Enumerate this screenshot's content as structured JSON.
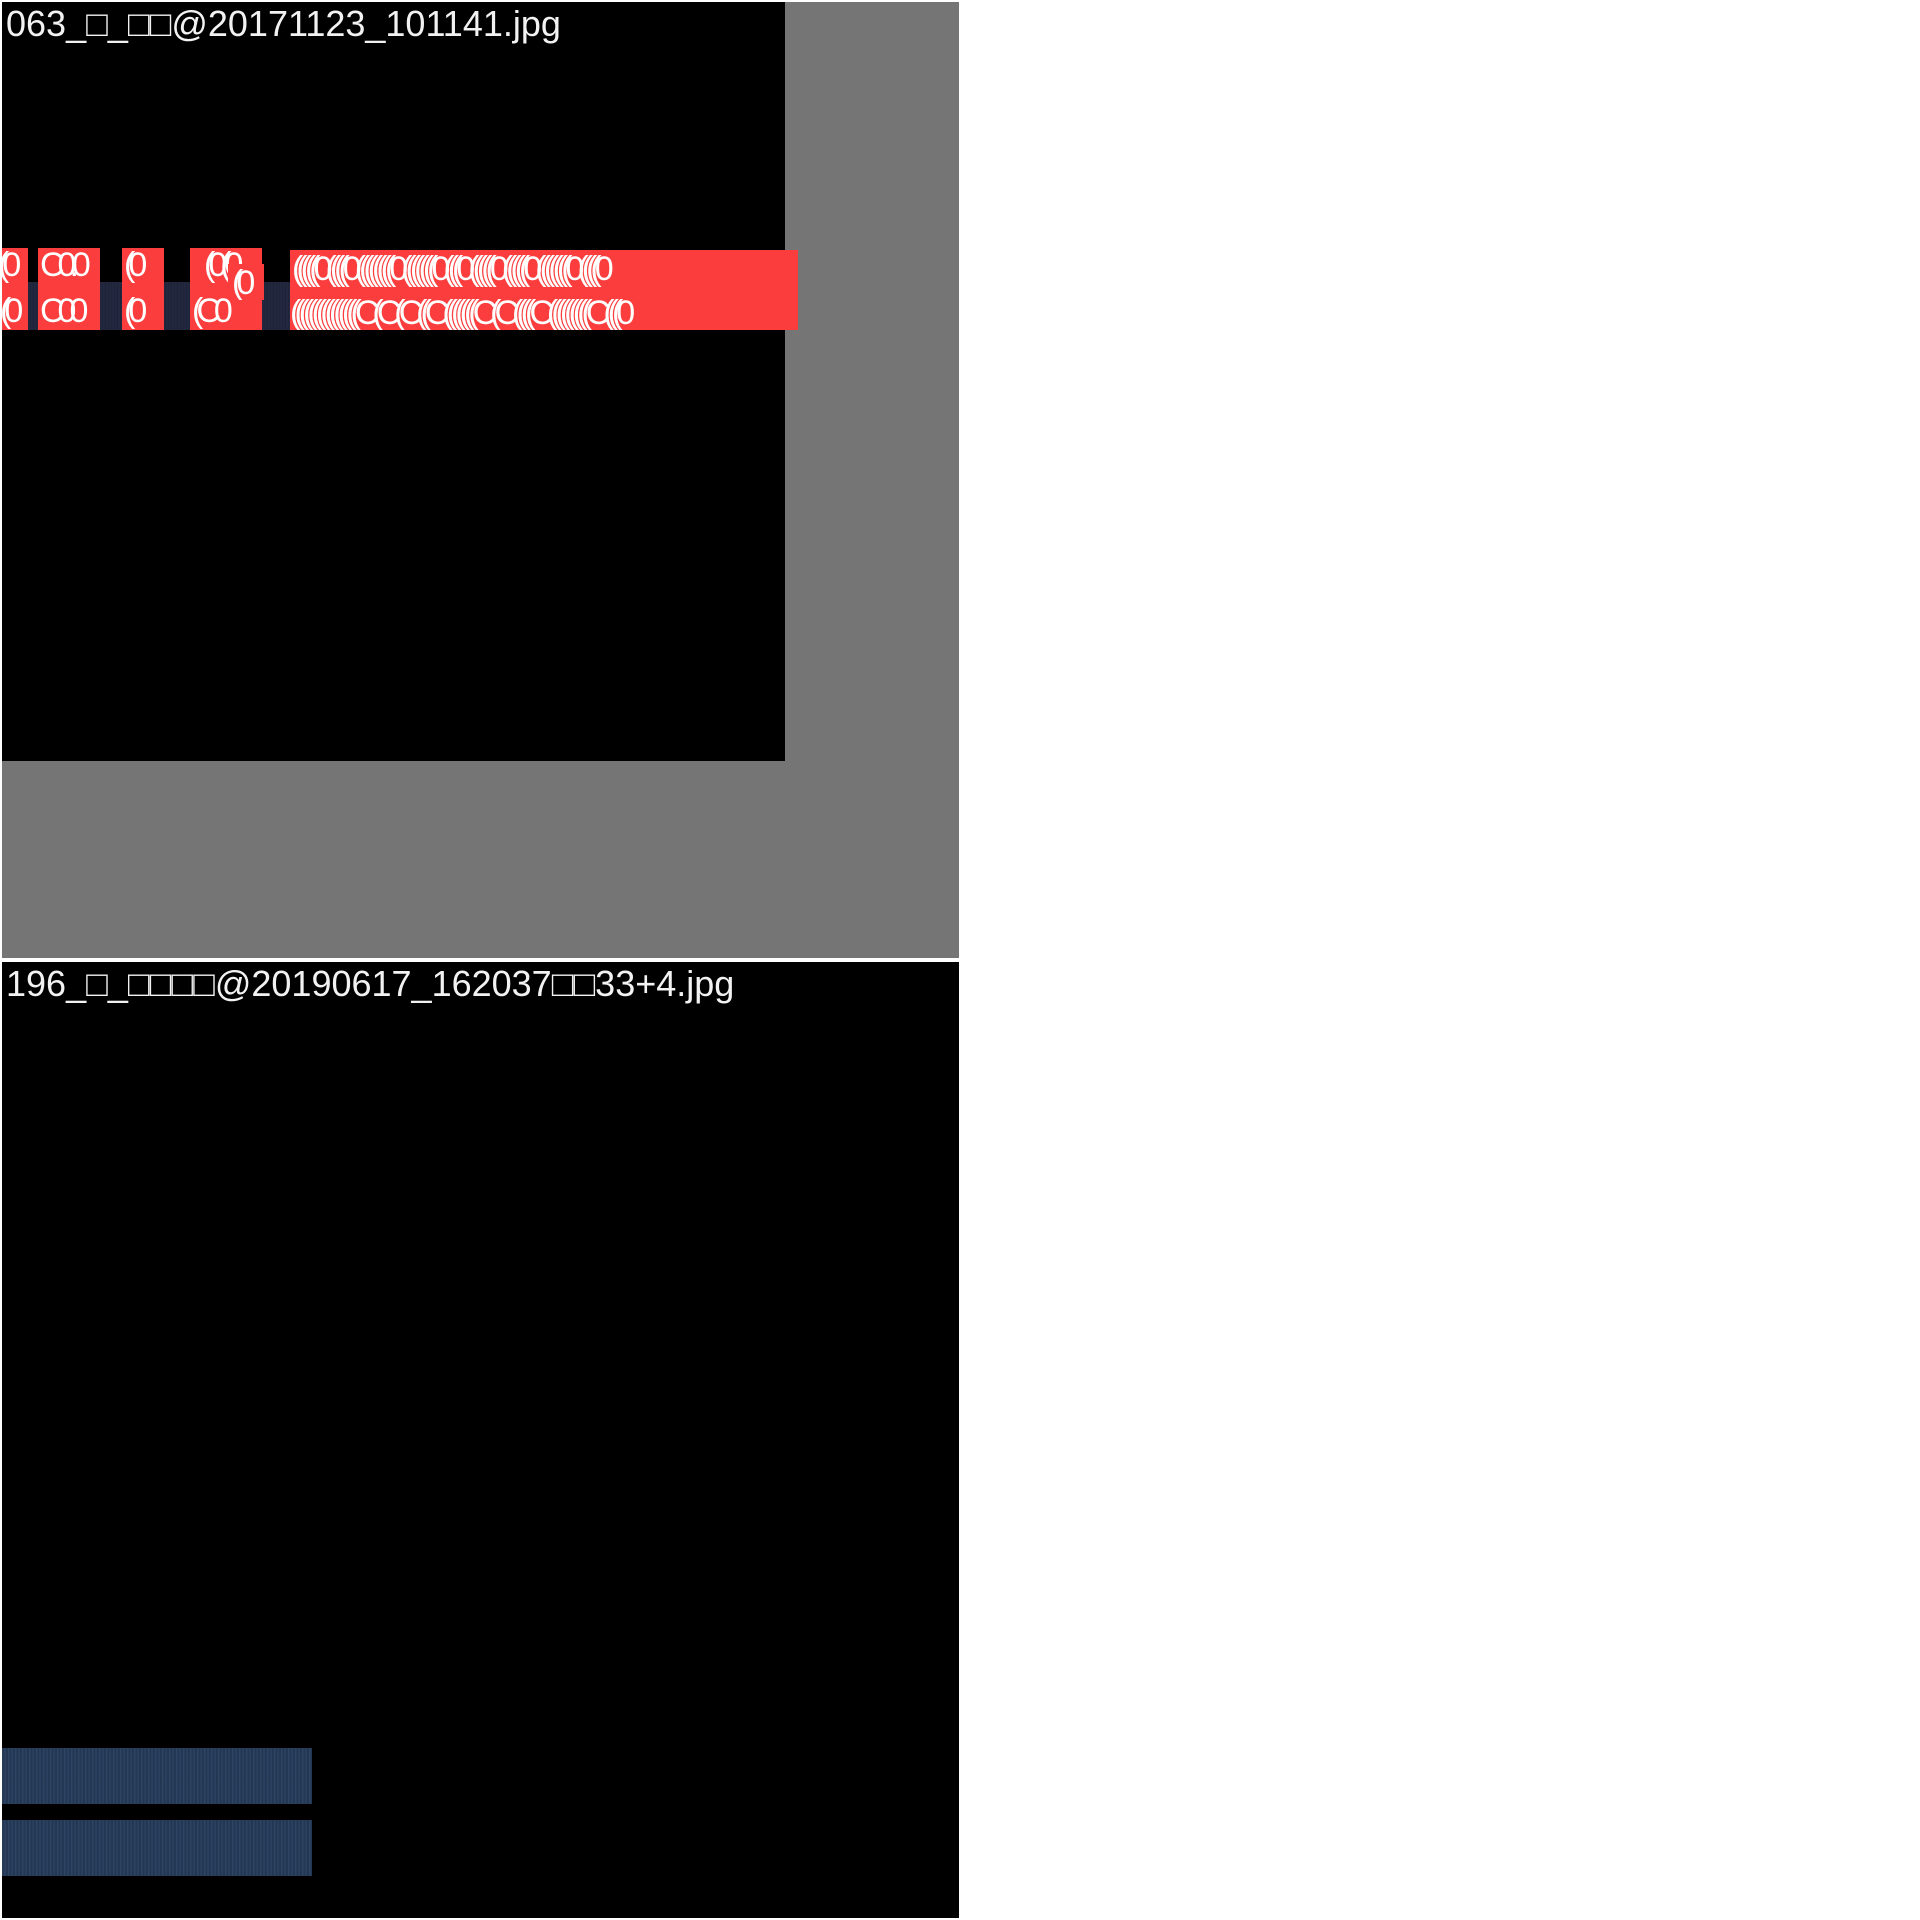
{
  "panels": [
    {
      "caption": "063_□_□□@20171123_101141.jpg",
      "background": "#757575",
      "image_background": "#000000",
      "annotation_color": "#fb3d3d",
      "annotation_glyphs": "(0"
    },
    {
      "caption": "196_□_□□□□@20190617_162037□□33+4.jpg",
      "background": "#000000",
      "strip_color": "#2a3f5c"
    }
  ]
}
